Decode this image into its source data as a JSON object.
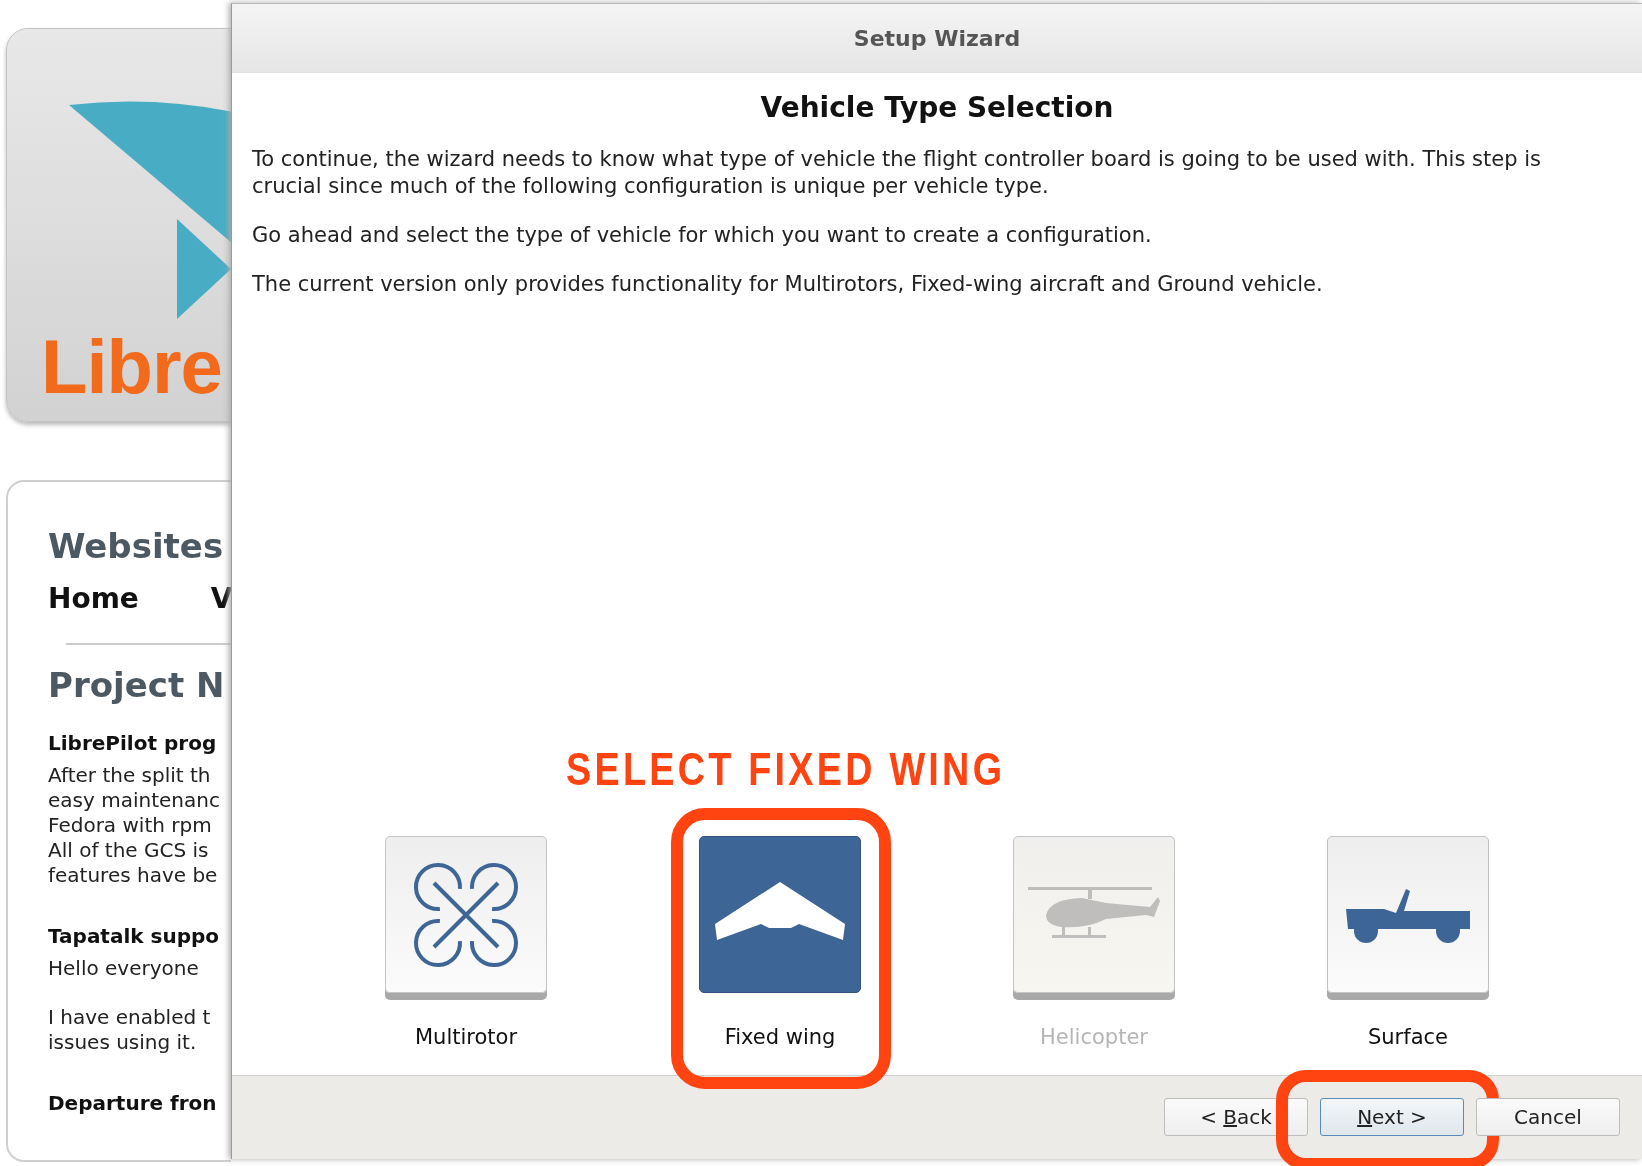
{
  "background_page": {
    "logo_text": "Libre",
    "site_title": "Websites",
    "nav": [
      "Home",
      "V"
    ],
    "section_title": "Project N",
    "posts": [
      {
        "title": "LibrePilot prog",
        "lines": [
          "After the split th",
          "easy maintenanc",
          "Fedora with rpm",
          "All of the GCS is",
          "features have be"
        ]
      },
      {
        "title": "Tapatalk suppo",
        "lines": [
          "Hello everyone"
        ],
        "more_lines": [
          "I have enabled t",
          "issues using it."
        ]
      },
      {
        "title": "Departure fron"
      }
    ]
  },
  "window": {
    "title": "Setup Wizard"
  },
  "page": {
    "heading": "Vehicle Type Selection",
    "paragraphs": [
      "To continue, the wizard needs to know what type of vehicle the flight controller board is going to be used with. This step is crucial since much of the following configuration is unique per vehicle type.",
      "Go ahead and select the type of vehicle for which you want to create a configuration.",
      "The current version only provides functionality for Multirotors, Fixed-wing aircraft and Ground vehicle."
    ]
  },
  "callout": "SELECT FIXED WING",
  "vehicles": [
    {
      "kind": "multirotor",
      "label": "Multirotor",
      "selected": false,
      "disabled": false,
      "highlighted": false
    },
    {
      "kind": "wing",
      "label": "Fixed wing",
      "selected": true,
      "disabled": false,
      "highlighted": true
    },
    {
      "kind": "helicopter",
      "label": "Helicopter",
      "selected": false,
      "disabled": true,
      "highlighted": false
    },
    {
      "kind": "ground",
      "label": "Surface",
      "selected": false,
      "disabled": false,
      "highlighted": false
    }
  ],
  "buttons": [
    {
      "before": "< ",
      "mnemonic": "B",
      "after": "ack",
      "default": false,
      "highlighted": false
    },
    {
      "mnemonic": "N",
      "after": "ext >",
      "default": true,
      "highlighted": true
    },
    {
      "before": "Cancel",
      "default": false,
      "highlighted": false
    }
  ]
}
